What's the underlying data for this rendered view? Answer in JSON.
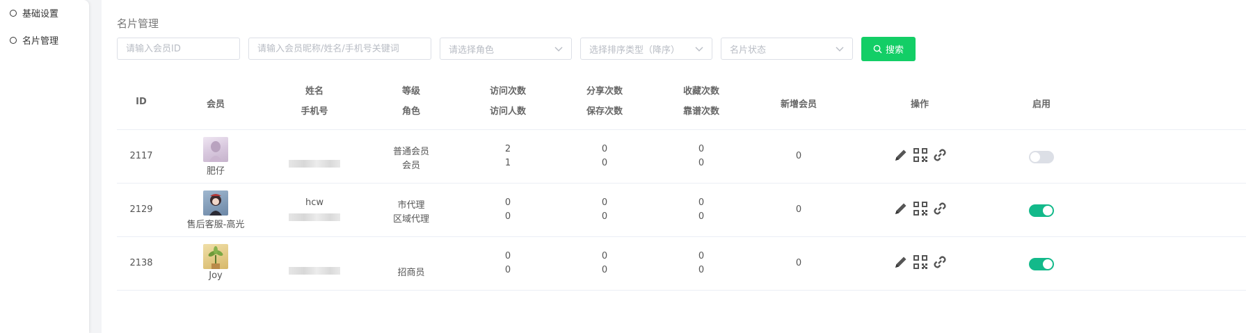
{
  "sidebar": {
    "items": [
      {
        "label": "基础设置"
      },
      {
        "label": "名片管理"
      }
    ]
  },
  "page": {
    "title": "名片管理"
  },
  "filters": {
    "member_id_placeholder": "请输入会员ID",
    "keyword_placeholder": "请输入会员昵称/姓名/手机号关键词",
    "role_placeholder": "请选择角色",
    "sort_placeholder": "选择排序类型（降序）",
    "status_placeholder": "名片状态",
    "search_label": "搜索"
  },
  "table": {
    "headers": {
      "id": "ID",
      "member": "会员",
      "name": "姓名",
      "phone": "手机号",
      "level": "等级",
      "role": "角色",
      "visits": "访问次数",
      "visitors": "访问人数",
      "shares": "分享次数",
      "saves": "保存次数",
      "favorites": "收藏次数",
      "reliable": "靠谱次数",
      "new_members": "新增会员",
      "actions": "操作",
      "enabled": "启用"
    },
    "rows": [
      {
        "id": "2117",
        "member": "肥仔",
        "name": "",
        "level": "普通会员",
        "role": "会员",
        "visits": "2",
        "visitors": "1",
        "shares": "0",
        "saves": "0",
        "favorites": "0",
        "reliable": "0",
        "new_members": "0",
        "enabled": false
      },
      {
        "id": "2129",
        "member": "售后客服-高光",
        "name": "hcw",
        "level": "市代理",
        "role": "区域代理",
        "visits": "0",
        "visitors": "0",
        "shares": "0",
        "saves": "0",
        "favorites": "0",
        "reliable": "0",
        "new_members": "0",
        "enabled": true
      },
      {
        "id": "2138",
        "member": "Joy",
        "name": "",
        "level": "",
        "role": "招商员",
        "visits": "0",
        "visitors": "0",
        "shares": "0",
        "saves": "0",
        "favorites": "0",
        "reliable": "0",
        "new_members": "0",
        "enabled": true
      }
    ]
  },
  "colors": {
    "accent": "#13ce66",
    "switch_on": "#13b98a",
    "switch_off": "#dcdfe6",
    "icon": "#555555"
  }
}
